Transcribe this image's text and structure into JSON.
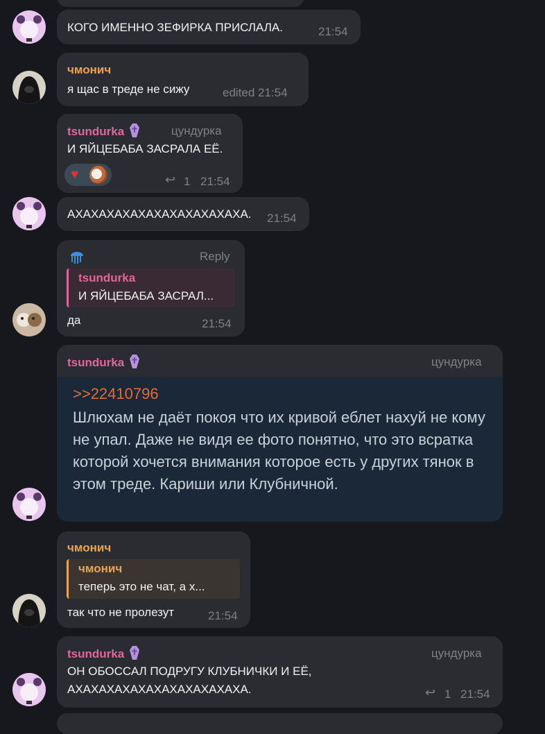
{
  "messages": [
    {
      "text": "КОГО ИМЕННО ЗЕФИРКА ПРИСЛАЛА.",
      "time": "21:54"
    },
    {
      "sender": "чмонич",
      "text": "я щас в треде не сижу",
      "time": "edited 21:54"
    },
    {
      "sender": "tsundurka",
      "rank": "цундурка",
      "text": "И ЯЙЦЕБАБА ЗАСРАЛА ЕЁ.",
      "replies": "1",
      "time": "21:54"
    },
    {
      "text": "АХАХАХАХАХАХАХАХАХАХАХА.",
      "time": "21:54"
    },
    {
      "reply_label": "Reply",
      "quote_name": "tsundurka",
      "quote_text": "И ЯЙЦЕБАБА ЗАСРАЛ...",
      "text": "да",
      "time": "21:54"
    },
    {
      "sender": "tsundurka",
      "rank": "цундурка",
      "ref": ">>22410796",
      "body": "Шлюхам не даёт покоя что их кривой еблет нахуй не кому не упал. Даже не видя ее фото понятно, что это всратка которой хочется внимания которое есть у других тянок в этом треде. Кариши или Клубничной."
    },
    {
      "sender": "чмонич",
      "quote_name": "чмонич",
      "quote_text": "теперь это не чат, а х...",
      "text": "так что не пролезут",
      "time": "21:54"
    },
    {
      "sender": "tsundurka",
      "rank": "цундурка",
      "text_line1": "ОН ОБОССАЛ ПОДРУГУ КЛУБНИЧКИ И ЕЁ,",
      "text_line2": "АХАХАХАХАХАХАХАХАХАХАХА.",
      "replies": "1",
      "time": "21:54"
    }
  ],
  "icons": {
    "reply": "reply-arrow-icon",
    "coffin": "coffin-emoji-icon",
    "jellyfish": "jellyfish-emoji-icon",
    "heart": "heart-reaction-icon"
  },
  "colors": {
    "background": "#17181d",
    "bubble": "#2b2c31",
    "pink_name": "#e0679a",
    "orange_name": "#e8a64e",
    "time": "#7e8187"
  }
}
